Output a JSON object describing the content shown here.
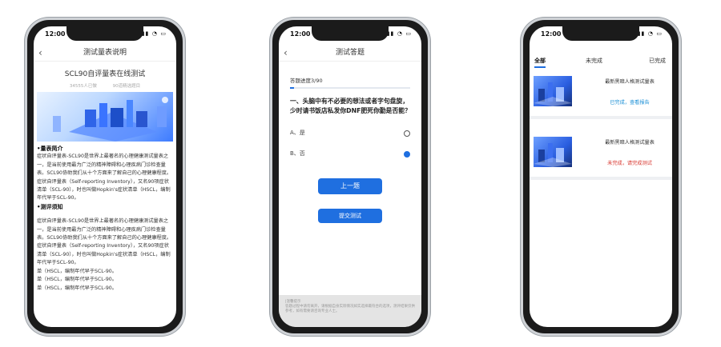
{
  "status_time": "12:00",
  "phone1": {
    "nav_title": "测试量表说明",
    "title": "SCL90自评量表在线测试",
    "meta": [
      "34555人已做",
      "90道精选题目"
    ],
    "paragraphs": [
      {
        "type": "h",
        "text": "•量表简介"
      },
      {
        "type": "p",
        "text": "症状自评量表-SCL90是世界上最著名的心理健康测试量表之一，是当前使用最为广泛的精神障碍和心理疾病门诊检查量表。SCL90协助我们从十个方面来了解自己的心理健康程度。"
      },
      {
        "type": "p",
        "text": "症状自评量表（Self-reporting Inventory），又名90项症状清单（SCL-90），时也叫做Hopkin's症状清单（HSCL，编制年代早于SCL-90。"
      },
      {
        "type": "h",
        "text": "•测评须知"
      },
      {
        "type": "p",
        "text": ""
      },
      {
        "type": "p",
        "text": "症状自评量表-SCL90是世界上最著名的心理健康测试量表之一，是当前使用最为广泛的精神障碍和心理疾病门诊检查量表。SCL90协助我们从十个方面来了解自己的心理健康程度。"
      },
      {
        "type": "p",
        "text": "症状自评量表（Self-reporting Inventory），又名90项症状清单（SCL-90），时也叫做Hopkin's症状清单（HSCL，编制年代早于SCL-90。"
      },
      {
        "type": "p",
        "text": "单（HSCL，编制年代早于SCL-90。"
      },
      {
        "type": "p",
        "text": "单（HSCL，编制年代早于SCL-90。"
      },
      {
        "type": "p",
        "text": "单（HSCL，编制年代早于SCL-90。"
      }
    ]
  },
  "phone2": {
    "nav_title": "测试答题",
    "progress_label": "答题进度3/90",
    "progress": 0.033,
    "question": "一、头脑中有不必要的想法或者字句盘旋，少时请书饭店私发你DNF肥死你勤是否能？",
    "options": [
      {
        "label": "A、是",
        "selected": false
      },
      {
        "label": "B、否",
        "selected": true
      }
    ],
    "prev_button": "上一题",
    "submit_button": "提交测试",
    "notice_title": "|温馨提示",
    "notice_text": "答题过程中请勿离开，请根据自身实际情况如实选择最符合的选项，测评结果仅供参考，如有需要请咨询专业人士。"
  },
  "phone3": {
    "tabs": [
      "全部",
      "未完成",
      "已完成"
    ],
    "active_tab": 0,
    "cards": [
      {
        "name": "最新黑暗人格测试量表",
        "status": "已完成，查看报告",
        "status_color": "#1a8fd6"
      },
      {
        "name": "最新黑暗人格测试量表",
        "status": "未完成，请完成测试",
        "status_color": "#d8372f"
      }
    ]
  },
  "colors": {
    "accent": "#1f6fe0",
    "done": "#1a8fd6",
    "undone": "#d8372f"
  }
}
